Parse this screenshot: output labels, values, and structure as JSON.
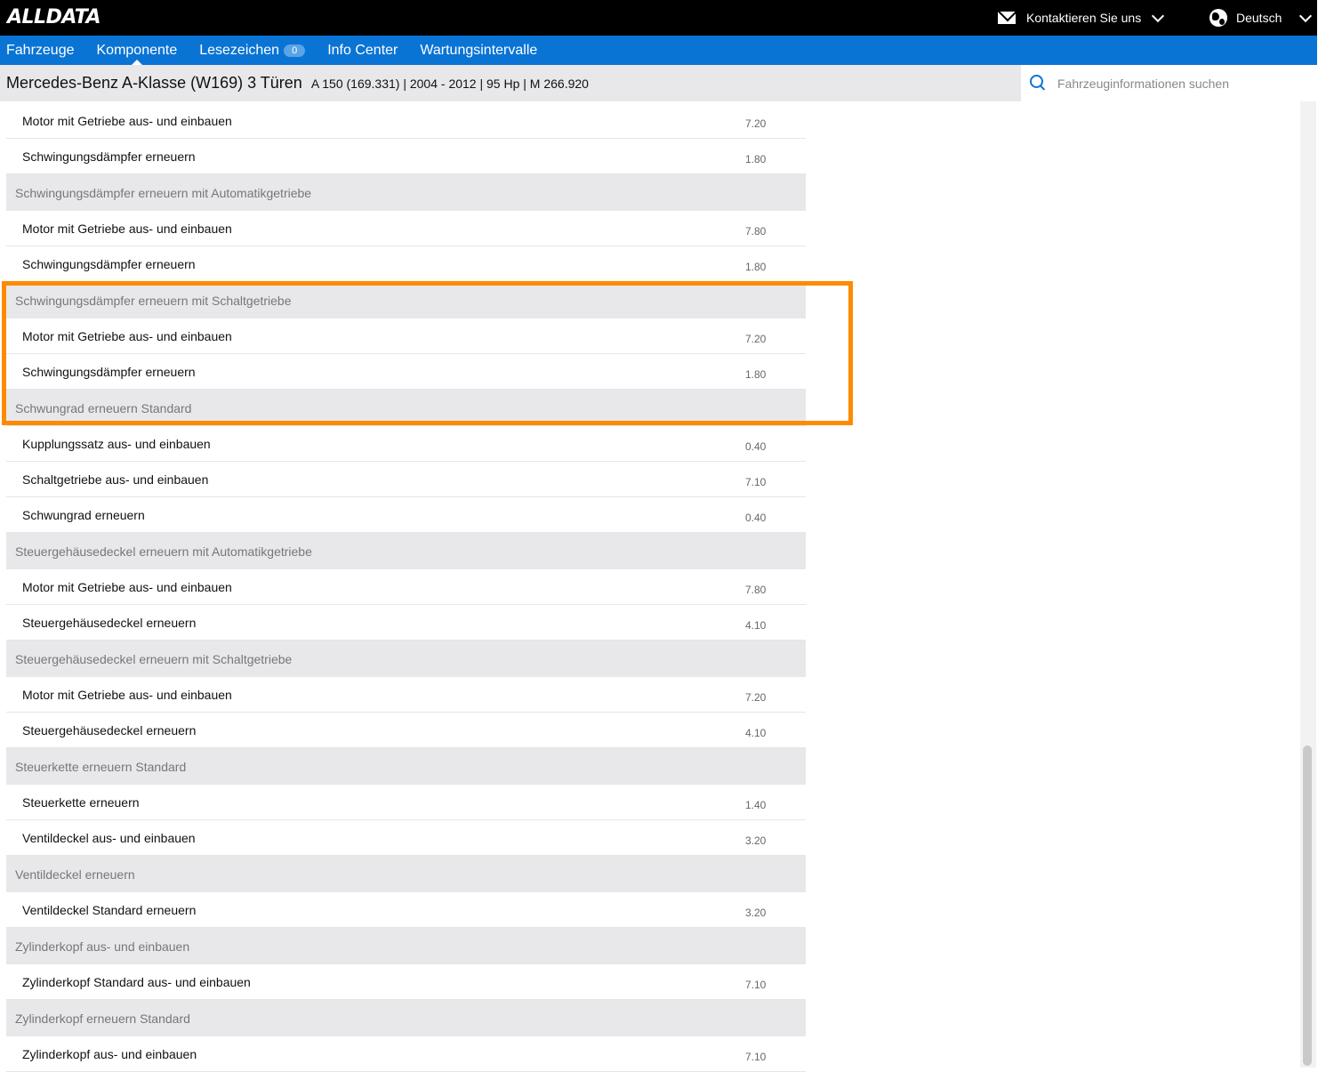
{
  "header": {
    "logo": "ALLDATA",
    "contact_label": "Kontaktieren Sie uns",
    "language_label": "Deutsch"
  },
  "nav": {
    "items": [
      {
        "label": "Fahrzeuge"
      },
      {
        "label": "Komponente"
      },
      {
        "label": "Lesezeichen",
        "badge": "0"
      },
      {
        "label": "Info Center"
      },
      {
        "label": "Wartungsintervalle"
      }
    ]
  },
  "vehicle": {
    "title": "Mercedes-Benz A-Klasse (W169) 3 Türen",
    "details": "A 150 (169.331) | 2004 - 2012 | 95 Hp | M 266.920"
  },
  "search": {
    "placeholder": "Fahrzeuginformationen suchen"
  },
  "rows": [
    {
      "type": "item",
      "label": "Motor mit Getriebe aus- und einbauen",
      "value": "7.20"
    },
    {
      "type": "item",
      "label": "Schwingungsdämpfer erneuern",
      "value": "1.80"
    },
    {
      "type": "group",
      "label": "Schwingungsdämpfer erneuern mit Automatikgetriebe"
    },
    {
      "type": "item",
      "label": "Motor mit Getriebe aus- und einbauen",
      "value": "7.80"
    },
    {
      "type": "item",
      "label": "Schwingungsdämpfer erneuern",
      "value": "1.80"
    },
    {
      "type": "group",
      "label": "Schwingungsdämpfer erneuern mit Schaltgetriebe"
    },
    {
      "type": "item",
      "label": "Motor mit Getriebe aus- und einbauen",
      "value": "7.20"
    },
    {
      "type": "item",
      "label": "Schwingungsdämpfer erneuern",
      "value": "1.80"
    },
    {
      "type": "group",
      "label": "Schwungrad erneuern Standard"
    },
    {
      "type": "item",
      "label": "Kupplungssatz aus- und einbauen",
      "value": "0.40"
    },
    {
      "type": "item",
      "label": "Schaltgetriebe aus- und einbauen",
      "value": "7.10"
    },
    {
      "type": "item",
      "label": "Schwungrad erneuern",
      "value": "0.40"
    },
    {
      "type": "group",
      "label": "Steuergehäusedeckel erneuern mit Automatikgetriebe"
    },
    {
      "type": "item",
      "label": "Motor mit Getriebe aus- und einbauen",
      "value": "7.80"
    },
    {
      "type": "item",
      "label": "Steuergehäusedeckel erneuern",
      "value": "4.10"
    },
    {
      "type": "group",
      "label": "Steuergehäusedeckel erneuern mit Schaltgetriebe"
    },
    {
      "type": "item",
      "label": "Motor mit Getriebe aus- und einbauen",
      "value": "7.20"
    },
    {
      "type": "item",
      "label": "Steuergehäusedeckel erneuern",
      "value": "4.10"
    },
    {
      "type": "group",
      "label": "Steuerkette erneuern Standard"
    },
    {
      "type": "item",
      "label": "Steuerkette erneuern",
      "value": "1.40"
    },
    {
      "type": "item",
      "label": "Ventildeckel aus- und einbauen",
      "value": "3.20"
    },
    {
      "type": "group",
      "label": "Ventildeckel erneuern"
    },
    {
      "type": "item",
      "label": "Ventildeckel Standard erneuern",
      "value": "3.20"
    },
    {
      "type": "group",
      "label": "Zylinderkopf aus- und einbauen"
    },
    {
      "type": "item",
      "label": "Zylinderkopf Standard aus- und einbauen",
      "value": "7.10"
    },
    {
      "type": "group",
      "label": "Zylinderkopf erneuern Standard"
    },
    {
      "type": "item",
      "label": "Zylinderkopf aus- und einbauen",
      "value": "7.10"
    }
  ],
  "colors": {
    "nav_blue": "#0a74d5",
    "highlight_orange": "#ff8a00",
    "group_bg": "#e8e8ea"
  }
}
